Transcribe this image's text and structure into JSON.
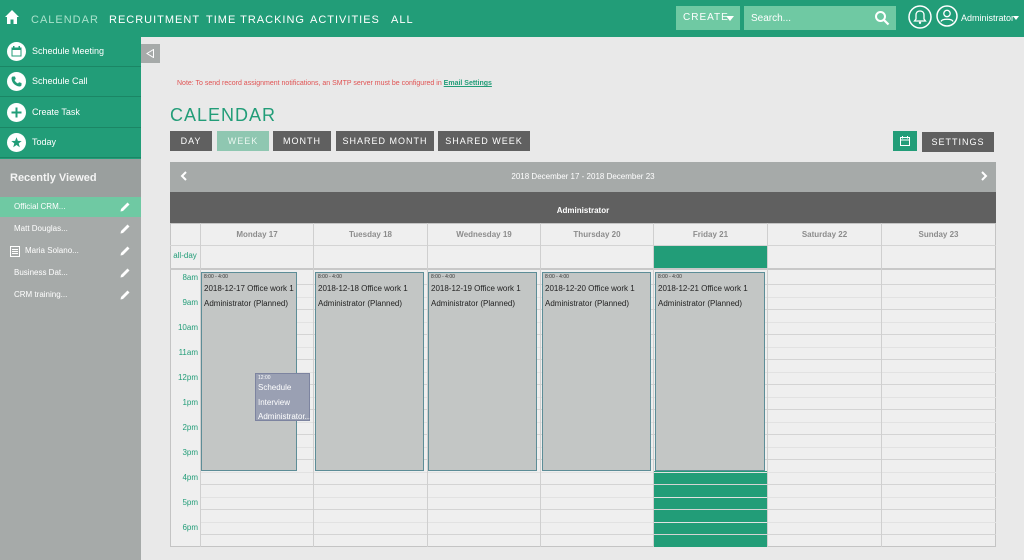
{
  "topnav": {
    "items": [
      "CALENDAR",
      "RECRUITMENT",
      "TIME TRACKING",
      "ACTIVITIES",
      "ALL"
    ],
    "create_label": "CREATE",
    "search_placeholder": "Search...",
    "user_name": "Administrator"
  },
  "sidebar": {
    "quick_actions": [
      "Schedule Meeting",
      "Schedule Call",
      "Create Task",
      "Today"
    ],
    "recently_viewed_title": "Recently Viewed",
    "recently_viewed": [
      "Official CRM...",
      "Matt Douglas...",
      "Maria Solano...",
      "Business Dat...",
      "CRM training..."
    ]
  },
  "main": {
    "note_text": "Note: To send record assignment notifications, an SMTP server must be configured in",
    "note_link": "Email Settings",
    "title": "CALENDAR",
    "view_buttons": [
      "DAY",
      "WEEK",
      "MONTH",
      "SHARED MONTH",
      "SHARED WEEK"
    ],
    "settings_label": "SETTINGS",
    "date_range": "2018 December 17 - 2018 December 23",
    "resource": "Administrator",
    "days": [
      "Monday 17",
      "Tuesday 18",
      "Wednesday 19",
      "Thursday 20",
      "Friday 21",
      "Saturday 22",
      "Sunday 23"
    ],
    "allday_label": "all-day",
    "hours": [
      "8am",
      "9am",
      "10am",
      "11am",
      "12pm",
      "1pm",
      "2pm",
      "3pm",
      "4pm",
      "5pm",
      "6pm"
    ],
    "events": [
      {
        "time": "8:00 - 4:00",
        "title": "2018-12-17 Office work 1",
        "sub": "Administrator (Planned)"
      },
      {
        "time": "8:00 - 4:00",
        "title": "2018-12-18 Office work 1",
        "sub": "Administrator (Planned)"
      },
      {
        "time": "8:00 - 4:00",
        "title": "2018-12-19 Office work 1",
        "sub": "Administrator (Planned)"
      },
      {
        "time": "8:00 - 4:00",
        "title": "2018-12-20 Office work 1",
        "sub": "Administrator (Planned)"
      },
      {
        "time": "8:00 - 4:00",
        "title": "2018-12-21 Office work 1",
        "sub": "Administrator (Planned)"
      }
    ],
    "interview_event": {
      "time": "12:00",
      "lines": [
        "Schedule",
        "Interview",
        "Administrator..."
      ]
    }
  },
  "colors": {
    "brand_green": "#229d78",
    "light_green": "#6fc9a3",
    "sidebar_gray": "#a6aaa9",
    "dark_gray": "#606060"
  }
}
